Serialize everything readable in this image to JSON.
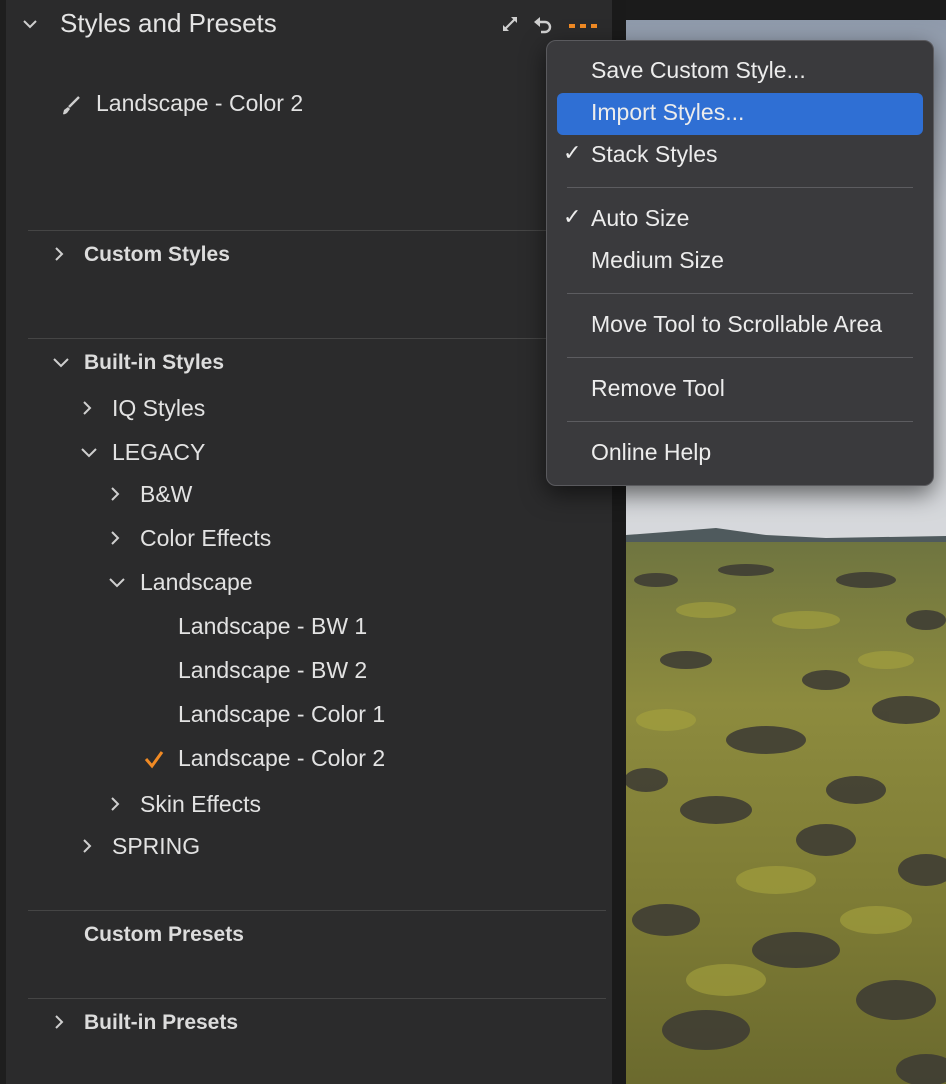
{
  "panel": {
    "title": "Styles and Presets",
    "applied_style": "Landscape - Color 2",
    "sections": {
      "custom_styles": "Custom Styles",
      "builtin_styles": "Built-in Styles",
      "custom_presets": "Custom Presets",
      "builtin_presets": "Built-in Presets"
    },
    "tree": {
      "iq_styles": "IQ Styles",
      "legacy": "LEGACY",
      "bw": "B&W",
      "color_effects": "Color Effects",
      "landscape": "Landscape",
      "landscape_bw1": "Landscape - BW 1",
      "landscape_bw2": "Landscape - BW 2",
      "landscape_color1": "Landscape - Color 1",
      "landscape_color2": "Landscape - Color 2",
      "skin_effects": "Skin Effects",
      "spring": "SPRING"
    }
  },
  "menu": {
    "save_custom_style": "Save Custom Style...",
    "import_styles": "Import Styles...",
    "stack_styles": "Stack Styles",
    "auto_size": "Auto Size",
    "medium_size": "Medium Size",
    "move_tool": "Move Tool to Scrollable Area",
    "remove_tool": "Remove Tool",
    "online_help": "Online Help",
    "check_glyph": "✓"
  },
  "icons": {
    "header": [
      "chevron-down-icon",
      "expand-icon",
      "reset-icon",
      "more-icon"
    ],
    "brush": "brush-icon",
    "applied_check": "checkmark-icon"
  },
  "colors": {
    "accent": "#f08a24",
    "menu_highlight": "#2f6fd4",
    "panel_bg": "#2b2b2c"
  }
}
